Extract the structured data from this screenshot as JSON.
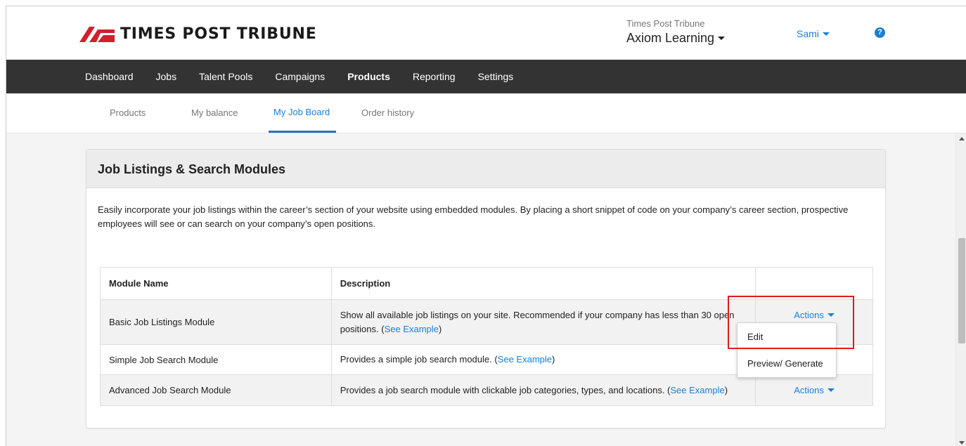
{
  "header": {
    "logo_text": "TIMES POST TRIBUNE",
    "org_label": "Times Post Tribune",
    "org_name": "Axiom Learning",
    "user_name": "Sami",
    "help_glyph": "?"
  },
  "nav": {
    "items": [
      "Dashboard",
      "Jobs",
      "Talent Pools",
      "Campaigns",
      "Products",
      "Reporting",
      "Settings"
    ],
    "active": "Products"
  },
  "subnav": {
    "items": [
      "Products",
      "My balance",
      "My Job Board",
      "Order history"
    ],
    "active": "My Job Board"
  },
  "card": {
    "title": "Job Listings & Search Modules",
    "intro": "Easily incorporate your job listings within the career’s section of your website using embedded modules. By placing a short snippet of code on your company’s career section, prospective employees will see or can search on your company’s open positions."
  },
  "table": {
    "headers": [
      "Module Name",
      "Description",
      ""
    ],
    "rows": [
      {
        "name": "Basic Job Listings Module",
        "desc": "Show all available job listings on your site. Recommended if your company has less than 30 open positions. (",
        "link": "See Example",
        "desc_end": ")",
        "action": "Actions"
      },
      {
        "name": "Simple Job Search Module",
        "desc": "Provides a simple job search module. (",
        "link": "See Example",
        "desc_end": ")",
        "action": ""
      },
      {
        "name": "Advanced Job Search Module",
        "desc": "Provides a job search module with clickable job categories, types, and locations. (",
        "link": "See Example",
        "desc_end": ")",
        "action": "Actions"
      }
    ]
  },
  "dropdown": {
    "items": [
      "Edit",
      "Preview/ Generate"
    ]
  },
  "colors": {
    "accent": "#1a7fd4",
    "nav_bg": "#333333",
    "highlight": "#e01a1a",
    "logo_red": "#d0202e"
  },
  "icons": {
    "logo": "tpt-logo-icon",
    "help": "help-circle-icon",
    "caret": "caret-down-icon"
  }
}
